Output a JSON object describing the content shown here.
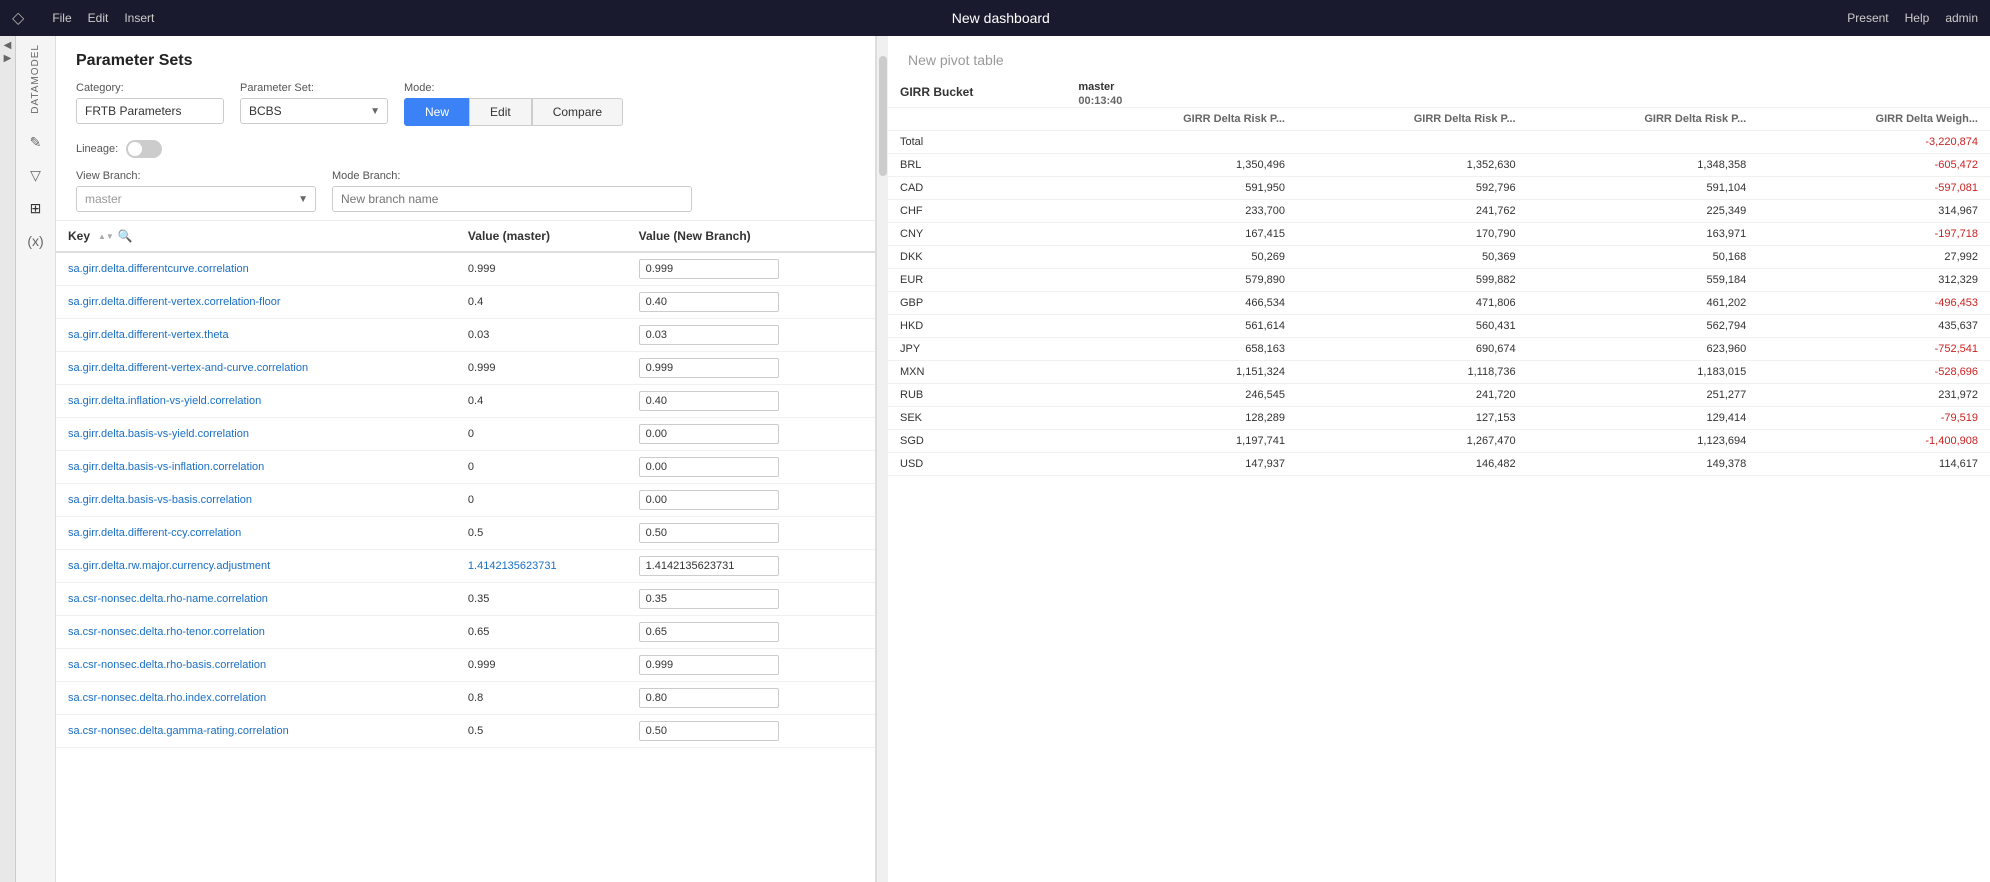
{
  "topbar": {
    "logo": "◇",
    "menu": [
      "File",
      "Edit",
      "Insert"
    ],
    "title": "New dashboard",
    "present": "Present",
    "help": "Help",
    "admin": "admin"
  },
  "panel": {
    "title": "Parameter Sets",
    "category_label": "Category:",
    "category_value": "FRTB Parameters",
    "param_set_label": "Parameter Set:",
    "param_set_value": "BCBS",
    "mode_label": "Mode:",
    "mode_buttons": [
      "New",
      "Edit",
      "Compare"
    ],
    "active_mode": "New",
    "lineage_label": "Lineage:",
    "view_branch_label": "View Branch:",
    "view_branch_value": "master",
    "mode_branch_label": "Mode Branch:",
    "mode_branch_placeholder": "New branch name"
  },
  "table": {
    "col_key": "Key",
    "col_value_master": "Value (master)",
    "col_value_new_branch": "Value (New Branch)",
    "rows": [
      {
        "key": "sa.girr.delta.differentcurve.correlation",
        "master": "0.999",
        "branch": "0.999"
      },
      {
        "key": "sa.girr.delta.different-vertex.correlation-floor",
        "master": "0.4",
        "branch": "0.40"
      },
      {
        "key": "sa.girr.delta.different-vertex.theta",
        "master": "0.03",
        "branch": "0.03"
      },
      {
        "key": "sa.girr.delta.different-vertex-and-curve.correlation",
        "master": "0.999",
        "branch": "0.999"
      },
      {
        "key": "sa.girr.delta.inflation-vs-yield.correlation",
        "master": "0.4",
        "branch": "0.40"
      },
      {
        "key": "sa.girr.delta.basis-vs-yield.correlation",
        "master": "0",
        "branch": "0.00"
      },
      {
        "key": "sa.girr.delta.basis-vs-inflation.correlation",
        "master": "0",
        "branch": "0.00"
      },
      {
        "key": "sa.girr.delta.basis-vs-basis.correlation",
        "master": "0",
        "branch": "0.00"
      },
      {
        "key": "sa.girr.delta.different-ccy.correlation",
        "master": "0.5",
        "branch": "0.50"
      },
      {
        "key": "sa.girr.delta.rw.major.currency.adjustment",
        "master": "1.4142135623731",
        "branch": "1.4142135623731",
        "link": true
      },
      {
        "key": "sa.csr-nonsec.delta.rho-name.correlation",
        "master": "0.35",
        "branch": "0.35"
      },
      {
        "key": "sa.csr-nonsec.delta.rho-tenor.correlation",
        "master": "0.65",
        "branch": "0.65"
      },
      {
        "key": "sa.csr-nonsec.delta.rho-basis.correlation",
        "master": "0.999",
        "branch": "0.999"
      },
      {
        "key": "sa.csr-nonsec.delta.rho.index.correlation",
        "master": "0.8",
        "branch": "0.80"
      },
      {
        "key": "sa.csr-nonsec.delta.gamma-rating.correlation",
        "master": "0.5",
        "branch": "0.50"
      }
    ]
  },
  "pivot": {
    "title": "New pivot table",
    "bucket_label": "GIRR Bucket",
    "master_label": "master",
    "time": "00:13:40",
    "columns": [
      "GIRR Delta Risk P...",
      "GIRR Delta Risk P...",
      "GIRR Delta Risk P...",
      "GIRR Delta Weigh..."
    ],
    "rows": [
      {
        "label": "Total",
        "c1": "",
        "c2": "",
        "c3": "",
        "c4": "-3,220,874",
        "c4_neg": true
      },
      {
        "label": "BRL",
        "c1": "1,350,496",
        "c2": "1,352,630",
        "c3": "1,348,358",
        "c4": "-605,472",
        "c4_neg": true
      },
      {
        "label": "CAD",
        "c1": "591,950",
        "c2": "592,796",
        "c3": "591,104",
        "c4": "-597,081",
        "c4_neg": true
      },
      {
        "label": "CHF",
        "c1": "233,700",
        "c2": "241,762",
        "c3": "225,349",
        "c4": "314,967",
        "c4_neg": false
      },
      {
        "label": "CNY",
        "c1": "167,415",
        "c2": "170,790",
        "c3": "163,971",
        "c4": "-197,718",
        "c4_neg": true
      },
      {
        "label": "DKK",
        "c1": "50,269",
        "c2": "50,369",
        "c3": "50,168",
        "c4": "27,992",
        "c4_neg": false
      },
      {
        "label": "EUR",
        "c1": "579,890",
        "c2": "599,882",
        "c3": "559,184",
        "c4": "312,329",
        "c4_neg": false
      },
      {
        "label": "GBP",
        "c1": "466,534",
        "c2": "471,806",
        "c3": "461,202",
        "c4": "-496,453",
        "c4_neg": true
      },
      {
        "label": "HKD",
        "c1": "561,614",
        "c2": "560,431",
        "c3": "562,794",
        "c4": "435,637",
        "c4_neg": false
      },
      {
        "label": "JPY",
        "c1": "658,163",
        "c2": "690,674",
        "c3": "623,960",
        "c4": "-752,541",
        "c4_neg": true
      },
      {
        "label": "MXN",
        "c1": "1,151,324",
        "c2": "1,118,736",
        "c3": "1,183,015",
        "c4": "-528,696",
        "c4_neg": true
      },
      {
        "label": "RUB",
        "c1": "246,545",
        "c2": "241,720",
        "c3": "251,277",
        "c4": "231,972",
        "c4_neg": false
      },
      {
        "label": "SEK",
        "c1": "128,289",
        "c2": "127,153",
        "c3": "129,414",
        "c4": "-79,519",
        "c4_neg": true
      },
      {
        "label": "SGD",
        "c1": "1,197,741",
        "c2": "1,267,470",
        "c3": "1,123,694",
        "c4": "-1,400,908",
        "c4_neg": true
      },
      {
        "label": "USD",
        "c1": "147,937",
        "c2": "146,482",
        "c3": "149,378",
        "c4": "114,617",
        "c4_neg": false
      }
    ]
  },
  "sidebar": {
    "label": "DATAMODEL",
    "icons": [
      "✎",
      "▽",
      "⊕",
      "(x)"
    ]
  }
}
